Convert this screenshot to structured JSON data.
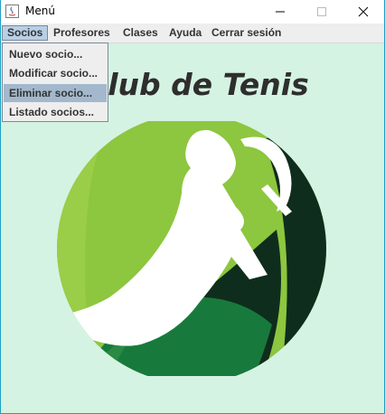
{
  "window": {
    "title": "Menú",
    "controls": [
      "minimize",
      "maximize",
      "close"
    ]
  },
  "menubar": {
    "items": [
      {
        "label": "Socios",
        "active": true
      },
      {
        "label": "Profesores"
      },
      {
        "label": "Clases"
      },
      {
        "label": "Ayuda"
      },
      {
        "label": "Cerrar sesión"
      }
    ]
  },
  "dropdown": {
    "items": [
      {
        "label": "Nuevo socio..."
      },
      {
        "label": "Modificar socio..."
      },
      {
        "label": "Eliminar socio...",
        "highlighted": true
      },
      {
        "label": "Listado socios..."
      }
    ]
  },
  "main": {
    "heading": "Club de Tenis",
    "logo_icon": "tennis-player-logo-icon"
  },
  "colors": {
    "background": "#d5f3e2",
    "logo_light_green": "#8dc63f",
    "logo_mid_green": "#177a3c",
    "logo_dark_green": "#0f2d1c",
    "menu_highlight": "#a3b8cc"
  }
}
